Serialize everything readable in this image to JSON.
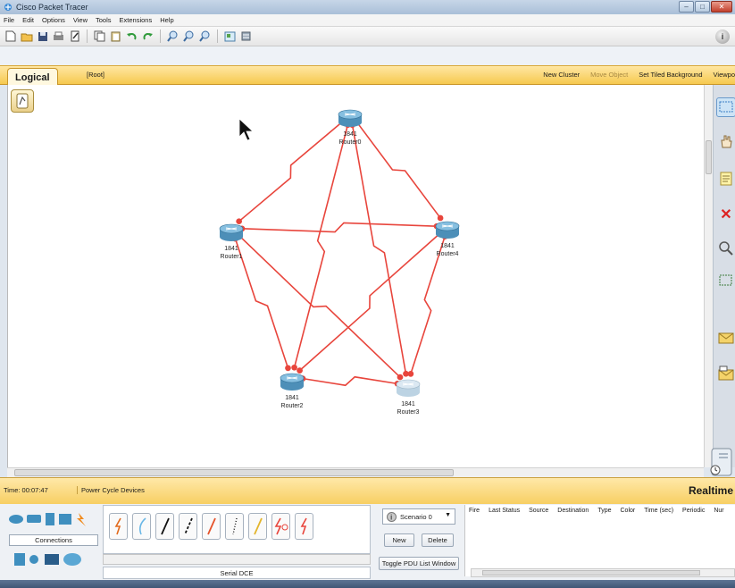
{
  "window": {
    "title": "Cisco Packet Tracer",
    "controls": [
      "minimize",
      "maximize",
      "close"
    ]
  },
  "menu": [
    "File",
    "Edit",
    "Options",
    "View",
    "Tools",
    "Extensions",
    "Help"
  ],
  "toolbar": {
    "icons": [
      "new-file-icon",
      "open-folder-icon",
      "save-icon",
      "print-icon",
      "activity-wizard-icon",
      "copy-icon",
      "paste-icon",
      "undo-icon",
      "redo-icon",
      "zoom-in-icon",
      "zoom-reset-icon",
      "zoom-out-icon",
      "drawing-palette-icon",
      "custom-device-icon",
      "info-icon"
    ]
  },
  "logical_bar": {
    "tab_label": "Logical",
    "root_label": "[Root]",
    "new_cluster": "New Cluster",
    "move_object": "Move Object",
    "set_tiled_background": "Set Tiled Background",
    "viewport": "Viewpo"
  },
  "topology": {
    "routers": [
      {
        "id": "r0",
        "model": "1841",
        "name": "Router0",
        "state": "selected"
      },
      {
        "id": "r1",
        "model": "1841",
        "name": "Router1",
        "state": "normal"
      },
      {
        "id": "r2",
        "model": "1841",
        "name": "Router2",
        "state": "normal"
      },
      {
        "id": "r3",
        "model": "1841",
        "name": "Router3",
        "state": "faded"
      },
      {
        "id": "r4",
        "model": "1841",
        "name": "Router4",
        "state": "normal"
      }
    ],
    "links": [
      [
        "r0",
        "r1"
      ],
      [
        "r0",
        "r4"
      ],
      [
        "r0",
        "r2"
      ],
      [
        "r0",
        "r3"
      ],
      [
        "r1",
        "r4"
      ],
      [
        "r1",
        "r2"
      ],
      [
        "r1",
        "r3"
      ],
      [
        "r4",
        "r2"
      ],
      [
        "r4",
        "r3"
      ],
      [
        "r2",
        "r3"
      ]
    ],
    "link_type": "serial",
    "link_color": "#e8453c"
  },
  "right_toolbar": [
    "select-icon",
    "hand-icon",
    "note-icon",
    "delete-icon",
    "inspect-icon",
    "resize-icon",
    "add-simple-pdu-icon",
    "add-complex-pdu-icon"
  ],
  "status": {
    "time": "Time: 00:07:47",
    "power_cycle": "Power Cycle Devices",
    "mode": "Realtime"
  },
  "device_panel": {
    "category_label": "Connections"
  },
  "cables": {
    "types": [
      "automatic-cable-icon",
      "console-cable-icon",
      "straight-through-icon",
      "crossover-icon",
      "fiber-icon",
      "phone-cable-icon",
      "coaxial-icon",
      "serial-dce-icon",
      "serial-dte-icon"
    ],
    "selected_label": "Serial DCE"
  },
  "scenario": {
    "selected": "Scenario 0",
    "new": "New",
    "delete": "Delete",
    "toggle": "Toggle PDU List Window"
  },
  "pdu_columns": [
    "Fire",
    "Last Status",
    "Source",
    "Destination",
    "Type",
    "Color",
    "Time (sec)",
    "Periodic",
    "Nur"
  ]
}
